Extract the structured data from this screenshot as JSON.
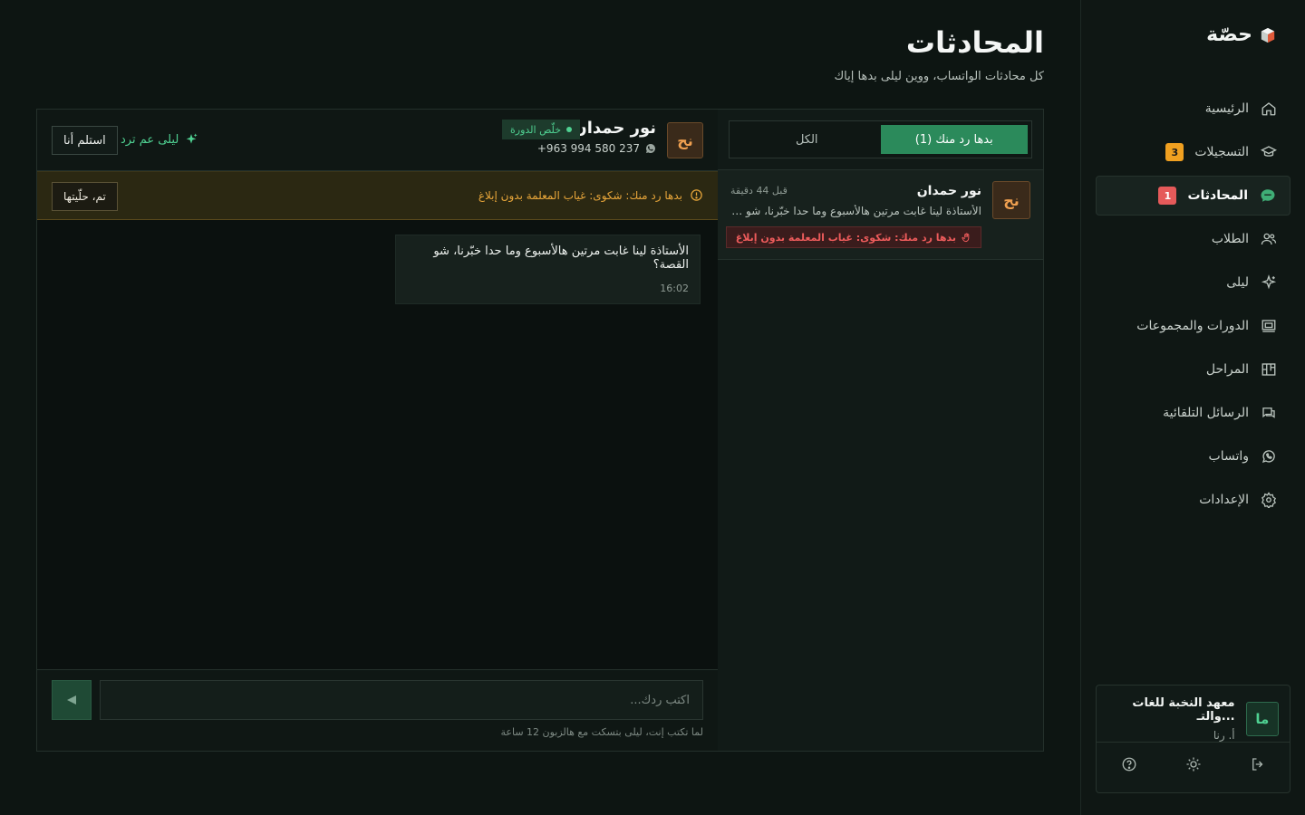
{
  "brand": {
    "name": "حصّة"
  },
  "nav": {
    "items": [
      {
        "label": "الرئيسية",
        "icon": "home-icon",
        "badge": null,
        "active": false
      },
      {
        "label": "التسجيلات",
        "icon": "graduation-cap-icon",
        "badge": "3",
        "active": false
      },
      {
        "label": "المحادثات",
        "icon": "chat-bubble-icon",
        "badge": "1",
        "active": true
      },
      {
        "label": "الطلاب",
        "icon": "users-icon",
        "badge": null,
        "active": false
      },
      {
        "label": "ليلى",
        "icon": "sparkle-icon",
        "badge": null,
        "active": false
      },
      {
        "label": "الدورات والمجموعات",
        "icon": "presentation-board-icon",
        "badge": null,
        "active": false
      },
      {
        "label": "المراحل",
        "icon": "kanban-icon",
        "badge": null,
        "active": false
      },
      {
        "label": "الرسائل التلقائية",
        "icon": "messages-icon",
        "badge": null,
        "active": false
      },
      {
        "label": "واتساب",
        "icon": "whatsapp-icon",
        "badge": null,
        "active": false
      },
      {
        "label": "الإعدادات",
        "icon": "gear-icon",
        "badge": null,
        "active": false
      }
    ]
  },
  "org": {
    "initials": "ما",
    "name": "معهد النخبة للغات والتـ...",
    "role": "أ. رنا"
  },
  "header": {
    "title": "المحادثات",
    "subtitle": "كل محادثات الواتساب، ووين ليلى بدها إياك"
  },
  "tabs": [
    {
      "label": "بدها رد منك (1)",
      "active": true
    },
    {
      "label": "الكل",
      "active": false
    }
  ],
  "conversations": [
    {
      "initials": "نح",
      "name": "نور حمدان",
      "time": "قبل 44 دقيقة",
      "preview": "الأستاذة لينا غابت مرتين هالأسبوع وما حدا خبّرنا، شو القـ...",
      "flag": "بدها رد منك: شكوى: غياب المعلمة بدون إبلاغ"
    }
  ],
  "chat": {
    "initials": "نح",
    "name": "نور حمدان",
    "status": "خلّص الدورة",
    "phone": "+963 994 580 237",
    "layla_status": "ليلى عم ترد",
    "takeover_label": "استلم أنا",
    "alert": "بدها رد منك: شكوى: غياب المعلمة بدون إبلاغ",
    "resolved_label": "تم، حلّيتها",
    "messages": [
      {
        "text": "الأستاذة لينا غابت مرتين هالأسبوع وما حدا خبّرنا، شو القصة؟",
        "time": "16:02"
      }
    ],
    "input_placeholder": "اكتب ردك...",
    "hint": "لما تكتب إنت، ليلى بتسكت مع هالزبون 12 ساعة"
  },
  "colors": {
    "accent": "#2b8a5b",
    "accent_text": "#4fd192",
    "warning": "#e8a63a",
    "danger": "#ec5b5b",
    "badge_orange": "#f0a020",
    "background": "#0d1512"
  }
}
